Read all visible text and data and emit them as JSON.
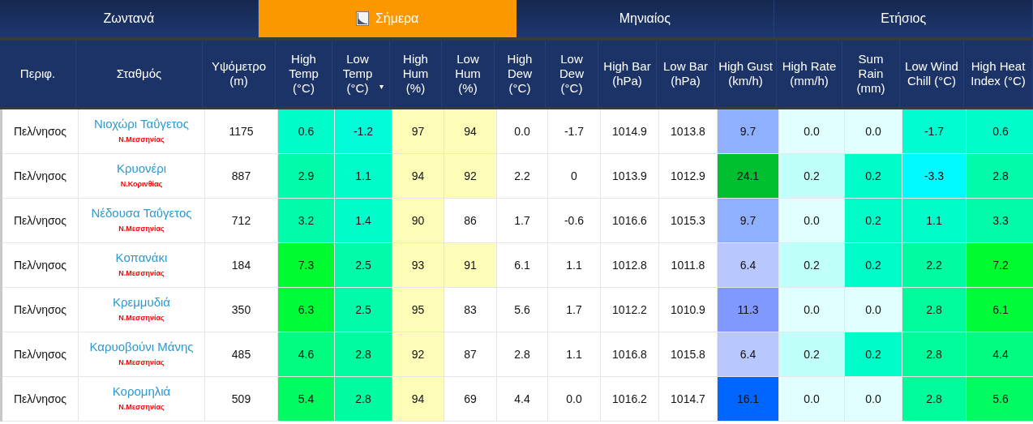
{
  "tabs": [
    {
      "label": "Ζωντανά",
      "selected": false,
      "icon": false
    },
    {
      "label": "Σήμερα",
      "selected": true,
      "icon": true
    },
    {
      "label": "Μηνιαίος",
      "selected": false,
      "icon": false
    },
    {
      "label": "Ετήσιος",
      "selected": false,
      "icon": false
    }
  ],
  "table": {
    "columns": [
      {
        "label": "Περιφ."
      },
      {
        "label": "Σταθμός"
      },
      {
        "label": "Υψόμετρο (m)"
      },
      {
        "label": "High Temp (°C)"
      },
      {
        "label": "Low Temp (°C)",
        "sort_indicator": "▾"
      },
      {
        "label": "High Hum (%)"
      },
      {
        "label": "Low Hum (%)"
      },
      {
        "label": "High Dew (°C)"
      },
      {
        "label": "Low Dew (°C)"
      },
      {
        "label": "High Bar (hPa)"
      },
      {
        "label": "Low Bar (hPa)"
      },
      {
        "label": "High Gust (km/h)"
      },
      {
        "label": "High Rate (mm/h)"
      },
      {
        "label": "Sum Rain (mm)"
      },
      {
        "label": "Low Wind Chill (°C)"
      },
      {
        "label": "High Heat Index (°C)"
      }
    ],
    "rows": [
      {
        "cells": [
          {
            "kind": "plain",
            "text": "Πελ/νησος"
          },
          {
            "kind": "station",
            "text": "Νιοχώρι Ταΰγετος",
            "subtitle": "Ν.Μεσσηνίας"
          },
          {
            "kind": "plain",
            "text": "1175"
          },
          {
            "kind": "plain",
            "text": "0.6",
            "color": "#00fcc8"
          },
          {
            "kind": "plain",
            "text": "-1.2",
            "color": "#00fcd8"
          },
          {
            "kind": "plain",
            "text": "97",
            "color": "#fdfdb8"
          },
          {
            "kind": "plain",
            "text": "94",
            "color": "#fdfdb8"
          },
          {
            "kind": "plain",
            "text": "0.0"
          },
          {
            "kind": "plain",
            "text": "-1.7"
          },
          {
            "kind": "plain",
            "text": "1014.9"
          },
          {
            "kind": "plain",
            "text": "1013.8"
          },
          {
            "kind": "plain",
            "text": "9.7",
            "color": "#8fb0ff"
          },
          {
            "kind": "plain",
            "text": "0.0",
            "color": "#e0fffe"
          },
          {
            "kind": "plain",
            "text": "0.0",
            "color": "#e0fffe"
          },
          {
            "kind": "plain",
            "text": "-1.7",
            "color": "#00fcd0"
          },
          {
            "kind": "plain",
            "text": "0.6",
            "color": "#00fcc8"
          }
        ]
      },
      {
        "cells": [
          {
            "kind": "plain",
            "text": "Πελ/νησος"
          },
          {
            "kind": "station",
            "text": "Κρυονέρι",
            "subtitle": "Ν.Κορινθίας"
          },
          {
            "kind": "plain",
            "text": "887"
          },
          {
            "kind": "plain",
            "text": "2.9",
            "color": "#00fcaa"
          },
          {
            "kind": "plain",
            "text": "1.1",
            "color": "#00fcc8"
          },
          {
            "kind": "plain",
            "text": "94",
            "color": "#fdfdb8"
          },
          {
            "kind": "plain",
            "text": "92",
            "color": "#fdfdb8"
          },
          {
            "kind": "plain",
            "text": "2.2"
          },
          {
            "kind": "plain",
            "text": "0"
          },
          {
            "kind": "plain",
            "text": "1013.9"
          },
          {
            "kind": "plain",
            "text": "1012.9"
          },
          {
            "kind": "plain",
            "text": "24.1",
            "color": "#00c030"
          },
          {
            "kind": "plain",
            "text": "0.2",
            "color": "#c0fffa"
          },
          {
            "kind": "plain",
            "text": "0.2",
            "color": "#00fcc8"
          },
          {
            "kind": "plain",
            "text": "-3.3",
            "color": "#00faff"
          },
          {
            "kind": "plain",
            "text": "2.8",
            "color": "#00fcaa"
          }
        ]
      },
      {
        "cells": [
          {
            "kind": "plain",
            "text": "Πελ/νησος"
          },
          {
            "kind": "station",
            "text": "Νέδουσα Ταΰγετος",
            "subtitle": "Ν.Μεσσηνίας"
          },
          {
            "kind": "plain",
            "text": "712"
          },
          {
            "kind": "plain",
            "text": "3.2",
            "color": "#00fcaa"
          },
          {
            "kind": "plain",
            "text": "1.4",
            "color": "#00fcc8"
          },
          {
            "kind": "plain",
            "text": "90",
            "color": "#fdfdb8"
          },
          {
            "kind": "plain",
            "text": "86"
          },
          {
            "kind": "plain",
            "text": "1.7"
          },
          {
            "kind": "plain",
            "text": "-0.6"
          },
          {
            "kind": "plain",
            "text": "1016.6"
          },
          {
            "kind": "plain",
            "text": "1015.3"
          },
          {
            "kind": "plain",
            "text": "9.7",
            "color": "#8fb0ff"
          },
          {
            "kind": "plain",
            "text": "0.0",
            "color": "#e0fffe"
          },
          {
            "kind": "plain",
            "text": "0.2",
            "color": "#00fcc8"
          },
          {
            "kind": "plain",
            "text": "1.1",
            "color": "#00fcc8"
          },
          {
            "kind": "plain",
            "text": "3.3",
            "color": "#00fcaa"
          }
        ]
      },
      {
        "cells": [
          {
            "kind": "plain",
            "text": "Πελ/νησος"
          },
          {
            "kind": "station",
            "text": "Κοπανάκι",
            "subtitle": "Ν.Μεσσηνίας"
          },
          {
            "kind": "plain",
            "text": "184"
          },
          {
            "kind": "plain",
            "text": "7.3",
            "color": "#00fc30"
          },
          {
            "kind": "plain",
            "text": "2.5",
            "color": "#00fcaa"
          },
          {
            "kind": "plain",
            "text": "93",
            "color": "#fdfdb8"
          },
          {
            "kind": "plain",
            "text": "91",
            "color": "#fdfdb8"
          },
          {
            "kind": "plain",
            "text": "6.1"
          },
          {
            "kind": "plain",
            "text": "1.1"
          },
          {
            "kind": "plain",
            "text": "1012.8"
          },
          {
            "kind": "plain",
            "text": "1011.8"
          },
          {
            "kind": "plain",
            "text": "6.4",
            "color": "#b8c8ff"
          },
          {
            "kind": "plain",
            "text": "0.2",
            "color": "#c0fffa"
          },
          {
            "kind": "plain",
            "text": "0.2",
            "color": "#00fcc8"
          },
          {
            "kind": "plain",
            "text": "2.2",
            "color": "#00fca0"
          },
          {
            "kind": "plain",
            "text": "7.2",
            "color": "#00fc30"
          }
        ]
      },
      {
        "cells": [
          {
            "kind": "plain",
            "text": "Πελ/νησος"
          },
          {
            "kind": "station",
            "text": "Κρεμμυδιά",
            "subtitle": "Ν.Μεσσηνίας"
          },
          {
            "kind": "plain",
            "text": "350"
          },
          {
            "kind": "plain",
            "text": "6.3",
            "color": "#00fc38"
          },
          {
            "kind": "plain",
            "text": "2.5",
            "color": "#00fcaa"
          },
          {
            "kind": "plain",
            "text": "95",
            "color": "#fdfdb8"
          },
          {
            "kind": "plain",
            "text": "83"
          },
          {
            "kind": "plain",
            "text": "5.6"
          },
          {
            "kind": "plain",
            "text": "1.7"
          },
          {
            "kind": "plain",
            "text": "1012.2"
          },
          {
            "kind": "plain",
            "text": "1010.9"
          },
          {
            "kind": "plain",
            "text": "11.3",
            "color": "#8098ff"
          },
          {
            "kind": "plain",
            "text": "0.0",
            "color": "#e0fffe"
          },
          {
            "kind": "plain",
            "text": "0.0",
            "color": "#e0fffe"
          },
          {
            "kind": "plain",
            "text": "2.8",
            "color": "#00fc9a"
          },
          {
            "kind": "plain",
            "text": "6.1",
            "color": "#00fc38"
          }
        ]
      },
      {
        "cells": [
          {
            "kind": "plain",
            "text": "Πελ/νησος"
          },
          {
            "kind": "station",
            "text": "Καρυοβούνι Μάνης",
            "subtitle": "Ν.Μεσσηνίας"
          },
          {
            "kind": "plain",
            "text": "485"
          },
          {
            "kind": "plain",
            "text": "4.6",
            "color": "#00fc80"
          },
          {
            "kind": "plain",
            "text": "2.8",
            "color": "#00fca0"
          },
          {
            "kind": "plain",
            "text": "92",
            "color": "#fdfdb8"
          },
          {
            "kind": "plain",
            "text": "87"
          },
          {
            "kind": "plain",
            "text": "2.8"
          },
          {
            "kind": "plain",
            "text": "1.1"
          },
          {
            "kind": "plain",
            "text": "1016.8"
          },
          {
            "kind": "plain",
            "text": "1015.8"
          },
          {
            "kind": "plain",
            "text": "6.4",
            "color": "#b8c8ff"
          },
          {
            "kind": "plain",
            "text": "0.2",
            "color": "#c0fffa"
          },
          {
            "kind": "plain",
            "text": "0.2",
            "color": "#00fcc8"
          },
          {
            "kind": "plain",
            "text": "2.8",
            "color": "#00fc9a"
          },
          {
            "kind": "plain",
            "text": "4.4",
            "color": "#00fc80"
          }
        ]
      },
      {
        "cells": [
          {
            "kind": "plain",
            "text": "Πελ/νησος"
          },
          {
            "kind": "station",
            "text": "Κορομηλιά",
            "subtitle": "Ν.Μεσσηνίας"
          },
          {
            "kind": "plain",
            "text": "509"
          },
          {
            "kind": "plain",
            "text": "5.4",
            "color": "#00fc60"
          },
          {
            "kind": "plain",
            "text": "2.8",
            "color": "#00fca0"
          },
          {
            "kind": "plain",
            "text": "94",
            "color": "#fdfdb8"
          },
          {
            "kind": "plain",
            "text": "69"
          },
          {
            "kind": "plain",
            "text": "4.4"
          },
          {
            "kind": "plain",
            "text": "0.0"
          },
          {
            "kind": "plain",
            "text": "1016.2"
          },
          {
            "kind": "plain",
            "text": "1014.7"
          },
          {
            "kind": "plain",
            "text": "16.1",
            "color": "#0066ff"
          },
          {
            "kind": "plain",
            "text": "0.0",
            "color": "#e0fffe"
          },
          {
            "kind": "plain",
            "text": "0.0",
            "color": "#e0fffe"
          },
          {
            "kind": "plain",
            "text": "2.8",
            "color": "#00fc9a"
          },
          {
            "kind": "plain",
            "text": "5.6",
            "color": "#00fc60"
          }
        ]
      }
    ]
  }
}
